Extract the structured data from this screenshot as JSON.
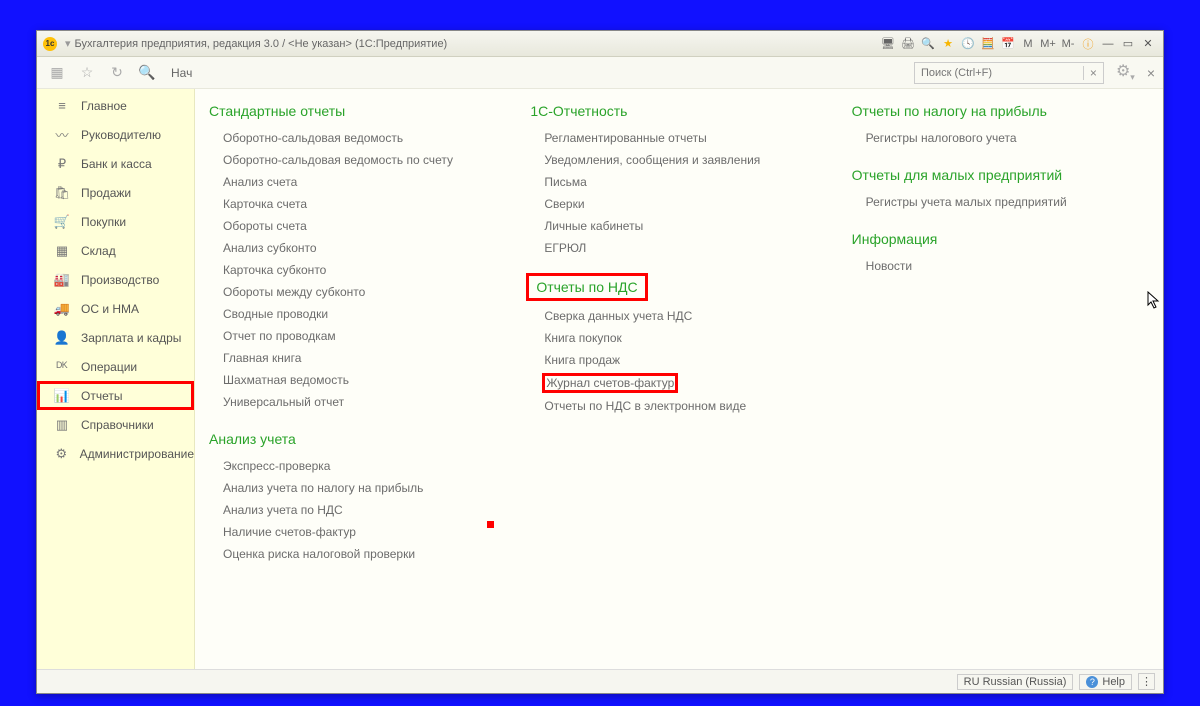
{
  "window": {
    "title": "Бухгалтерия предприятия, редакция 3.0 / <Не указан>  (1С:Предприятие)",
    "m": "M",
    "mplus": "M+",
    "mminus": "M-"
  },
  "toolbar": {
    "tab": "Нач",
    "search_placeholder": "Поиск (Ctrl+F)"
  },
  "sidebar": [
    {
      "icon": "≡",
      "label": "Главное"
    },
    {
      "icon": "〰",
      "label": "Руководителю"
    },
    {
      "icon": "₽",
      "label": "Банк и касса"
    },
    {
      "icon": "🛍",
      "label": "Продажи"
    },
    {
      "icon": "🛒",
      "label": "Покупки"
    },
    {
      "icon": "▦",
      "label": "Склад"
    },
    {
      "icon": "🏭",
      "label": "Производство"
    },
    {
      "icon": "🚚",
      "label": "ОС и НМА"
    },
    {
      "icon": "👤",
      "label": "Зарплата и кадры"
    },
    {
      "icon": "ᴰᴷ",
      "label": "Операции"
    },
    {
      "icon": "📊",
      "label": "Отчеты",
      "hl": true
    },
    {
      "icon": "▥",
      "label": "Справочники"
    },
    {
      "icon": "⚙",
      "label": "Администрирование"
    }
  ],
  "col1": {
    "h1": "Стандартные отчеты",
    "items1": [
      "Оборотно-сальдовая ведомость",
      "Оборотно-сальдовая ведомость по счету",
      "Анализ счета",
      "Карточка счета",
      "Обороты счета",
      "Анализ субконто",
      "Карточка субконто",
      "Обороты между субконто",
      "Сводные проводки",
      "Отчет по проводкам",
      "Главная книга",
      "Шахматная ведомость",
      "Универсальный отчет"
    ],
    "h2": "Анализ учета",
    "items2": [
      "Экспресс-проверка",
      "Анализ учета по налогу на прибыль",
      "Анализ учета по НДС",
      "Наличие счетов-фактур",
      "Оценка риска налоговой проверки"
    ]
  },
  "col2": {
    "h1": "1С-Отчетность",
    "items1": [
      "Регламентированные отчеты",
      "Уведомления, сообщения и заявления",
      "Письма",
      "Сверки",
      "Личные кабинеты",
      "ЕГРЮЛ"
    ],
    "h2": "Отчеты по НДС",
    "items2": [
      "Сверка данных учета НДС",
      "Книга покупок",
      "Книга продаж"
    ],
    "hl_item": "Журнал счетов-фактур",
    "items3": [
      "Отчеты по НДС в электронном виде"
    ]
  },
  "col3": {
    "h1": "Отчеты по налогу на прибыль",
    "items1": [
      "Регистры налогового учета"
    ],
    "h2": "Отчеты для малых предприятий",
    "items2": [
      "Регистры учета малых предприятий"
    ],
    "h3": "Информация",
    "items3": [
      "Новости"
    ]
  },
  "status": {
    "lang": "RU Russian (Russia)",
    "help": "Help"
  }
}
